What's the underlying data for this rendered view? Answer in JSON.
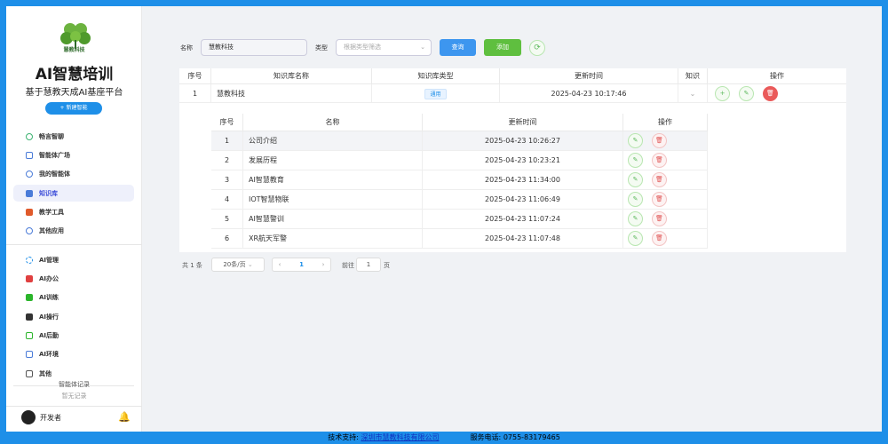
{
  "sidebar": {
    "logo_text": "慧教科技",
    "title": "AI智慧培训",
    "subtitle": "基于慧教天成AI基座平台",
    "new_button": "+ 新建智能",
    "items": [
      {
        "label": "畅言智聊",
        "color": "#3cb371"
      },
      {
        "label": "智能体广场",
        "color": "#4a7bd8"
      },
      {
        "label": "我的智能体",
        "color": "#4a7bd8"
      },
      {
        "label": "知识库",
        "color": "#4a7bd8"
      },
      {
        "label": "教学工具",
        "color": "#e05a2b"
      },
      {
        "label": "其他应用",
        "color": "#4a7bd8"
      }
    ],
    "items2": [
      {
        "label": "AI管理",
        "color": "#1e8fe8"
      },
      {
        "label": "AI办公",
        "color": "#e04040"
      },
      {
        "label": "AI训练",
        "color": "#2bb52b"
      },
      {
        "label": "AI操行",
        "color": "#333333"
      },
      {
        "label": "AI后勤",
        "color": "#2bb52b"
      },
      {
        "label": "AI环境",
        "color": "#4a7bd8"
      },
      {
        "label": "其他",
        "color": "#555555"
      }
    ],
    "records_title": "智能体记录",
    "records_empty": "暂无记录",
    "user_name": "开发者"
  },
  "filter": {
    "name_label": "名称",
    "name_value": "慧教科技",
    "type_label": "类型",
    "type_placeholder": "根据类型筛选",
    "query_button": "查询",
    "add_button": "添加"
  },
  "table": {
    "headers": [
      "序号",
      "知识库名称",
      "知识库类型",
      "更新时间",
      "知识",
      "操作"
    ],
    "rows": [
      {
        "index": "1",
        "name": "慧教科技",
        "type": "通用",
        "updated": "2025-04-23 10:17:46"
      }
    ]
  },
  "subtable": {
    "headers": [
      "序号",
      "名称",
      "更新时间",
      "操作"
    ],
    "rows": [
      {
        "index": "1",
        "name": "公司介绍",
        "updated": "2025-04-23 10:26:27"
      },
      {
        "index": "2",
        "name": "发展历程",
        "updated": "2025-04-23 10:23:21"
      },
      {
        "index": "3",
        "name": "AI智慧教育",
        "updated": "2025-04-23 11:34:00"
      },
      {
        "index": "4",
        "name": "IOT智慧物联",
        "updated": "2025-04-23 11:06:49"
      },
      {
        "index": "5",
        "name": "AI智慧警训",
        "updated": "2025-04-23 11:07:24"
      },
      {
        "index": "6",
        "name": "XR航天军警",
        "updated": "2025-04-23 11:07:48"
      }
    ]
  },
  "pagination": {
    "total": "共 1 条",
    "page_size": "20条/页",
    "current_page": "1",
    "goto_label": "前往",
    "goto_value": "1",
    "page_suffix": "页"
  },
  "footer": {
    "support_label": "技术支持:",
    "company": "深圳市慧教科技有限公司",
    "phone_label": "服务电话:",
    "phone": "0755-83179465"
  }
}
